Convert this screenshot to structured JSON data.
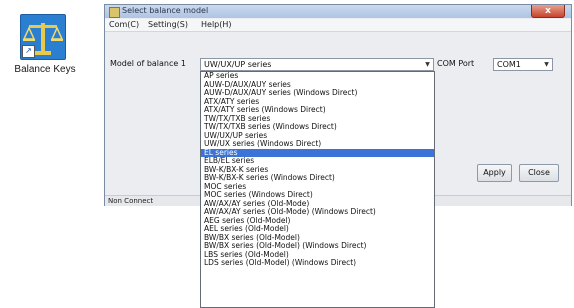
{
  "desktop": {
    "icon_name": "balance-scale-icon",
    "label": "Balance Keys"
  },
  "window": {
    "title": "Select balance model",
    "close_label": "x",
    "menu": [
      "Com(C)",
      "Setting(S)",
      "Help(H)"
    ],
    "model_label": "Model of balance 1",
    "model_value": "UW/UX/UP series",
    "com_label": "COM Port",
    "com_value": "COM1",
    "apply_label": "Apply",
    "close_button_label": "Close",
    "status": "Non Connect"
  },
  "dropdown": {
    "selected_index": 9,
    "options": [
      "AP series",
      "AUW-D/AUX/AUY series",
      "AUW-D/AUX/AUY series (Windows Direct)",
      "ATX/ATY series",
      "ATX/ATY series (Windows Direct)",
      "TW/TX/TXB series",
      "TW/TX/TXB series (Windows Direct)",
      "UW/UX/UP series",
      "UW/UX series (Windows Direct)",
      "EL series",
      "ELB/EL series",
      "BW-K/BX-K series",
      "BW-K/BX-K series (Windows Direct)",
      "MOC series",
      "MOC series (Windows Direct)",
      "AW/AX/AY series (Old-Mode)",
      "AW/AX/AY series (Old-Mode) (Windows Direct)",
      "AEG series (Old-Model)",
      "AEL series (Old-Model)",
      "BW/BX series (Old-Model)",
      "BW/BX series (Old-Model) (Windows Direct)",
      "LBS series (Old-Model)",
      "LDS series (Old-Model) (Windows Direct)"
    ]
  },
  "colors": {
    "selection": "#3b74d6",
    "title_close": "#c7442b",
    "icon_tile": "#2b7fd1"
  }
}
